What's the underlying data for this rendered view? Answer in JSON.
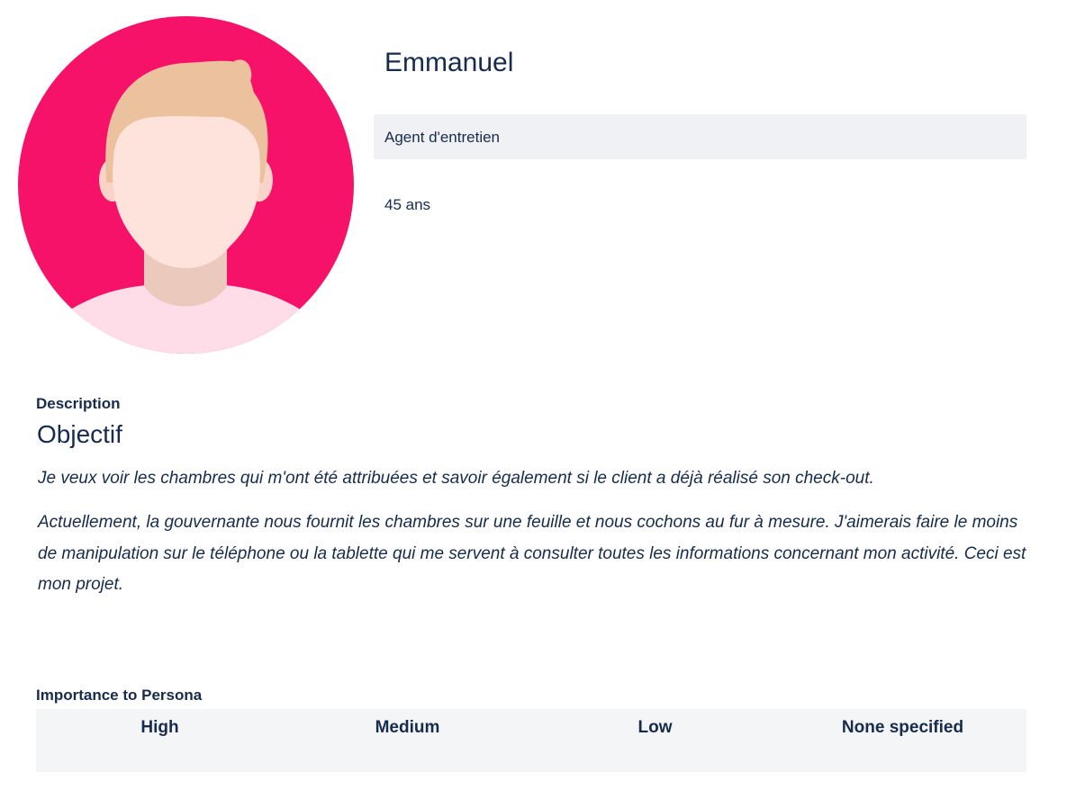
{
  "persona": {
    "name": "Emmanuel",
    "role": "Agent d'entretien",
    "age": "45 ans",
    "avatar_icon": "person-avatar-icon"
  },
  "description": {
    "label": "Description",
    "heading": "Objectif",
    "paragraphs": [
      "Je veux voir les chambres qui m'ont été attribuées et savoir également si le client a déjà réalisé son check-out.",
      "Actuellement, la gouvernante nous fournit les chambres sur une feuille et nous cochons au fur à mesure. J'aimerais faire le moins de manipulation sur le téléphone ou la tablette qui me servent à consulter toutes les informations concernant mon activité. Ceci est mon projet."
    ]
  },
  "importance": {
    "label": "Importance to Persona",
    "columns": [
      "High",
      "Medium",
      "Low",
      "None specified"
    ]
  },
  "colors": {
    "avatar_background": "#f51268",
    "text": "#172b4d",
    "role_box_background": "#f0f1f4",
    "table_background": "#f4f5f7"
  }
}
